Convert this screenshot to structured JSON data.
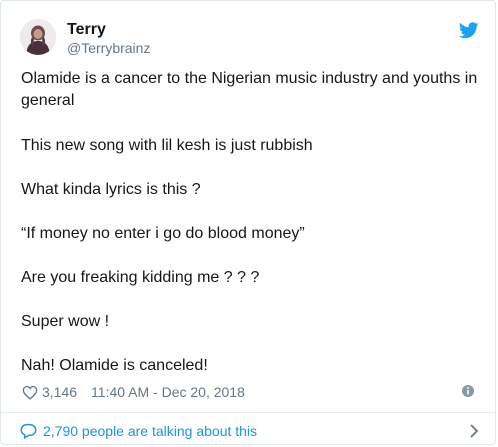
{
  "author": {
    "display_name": "Terry",
    "handle": "@Terrybrainz"
  },
  "icons": {
    "brand": "twitter-bird-icon",
    "like": "heart-icon",
    "info": "info-icon",
    "reply": "speech-bubble-icon",
    "more": "chevron-right-icon"
  },
  "tweet": {
    "paragraphs": [
      "Olamide is a cancer to the Nigerian music industry and youths in",
      "general",
      "This new song with lil kesh is just rubbish",
      "What kinda lyrics is this ?",
      "“If money no enter i go do blood money”",
      "Are you freaking kidding me ? ? ?",
      "Super wow !",
      "Nah! Olamide is canceled!"
    ]
  },
  "meta": {
    "likes": "3,146",
    "timestamp": "11:40 AM - Dec 20, 2018"
  },
  "footer": {
    "talking_label": "2,790 people are talking about this"
  },
  "colors": {
    "text": "#14171a",
    "secondary": "#657786",
    "link": "#1b95e0",
    "border": "#e1e8ed"
  }
}
